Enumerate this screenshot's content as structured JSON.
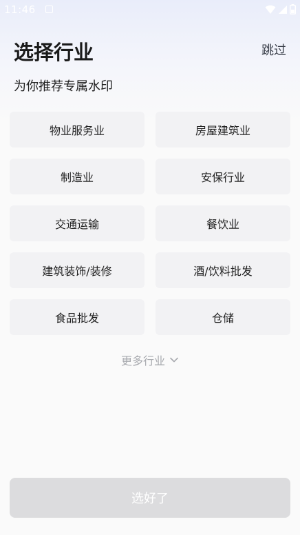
{
  "status_bar": {
    "time": "11:46"
  },
  "header": {
    "title": "选择行业",
    "skip_label": "跳过"
  },
  "subtitle": "为你推荐专属水印",
  "industries": [
    "物业服务业",
    "房屋建筑业",
    "制造业",
    "安保行业",
    "交通运输",
    "餐饮业",
    "建筑装饰/装修",
    "酒/饮料批发",
    "食品批发",
    "仓储"
  ],
  "more": {
    "label": "更多行业",
    "icon": "chevron-down-icon"
  },
  "confirm_button": {
    "label": "选好了",
    "state": "disabled"
  },
  "colors": {
    "header_gradient_top": "#e9edfa",
    "background": "#fafafa",
    "tile": "#f2f2f4",
    "button_disabled": "#dcdcde",
    "muted_text": "#a7a9ae"
  }
}
